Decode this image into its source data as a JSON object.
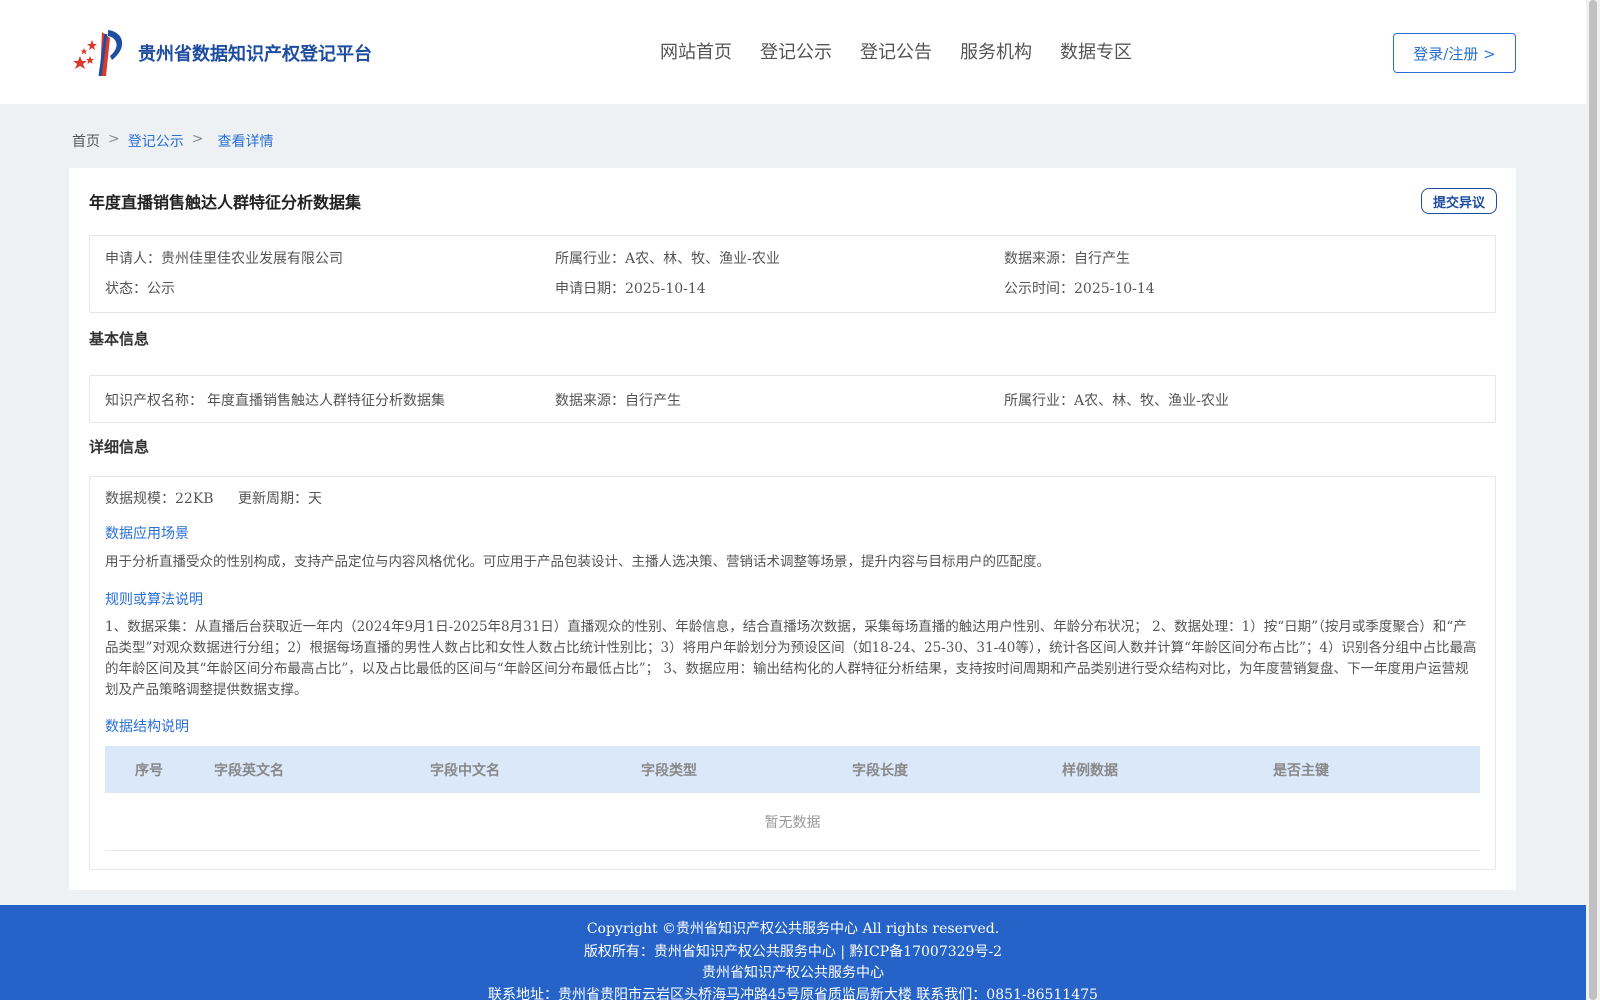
{
  "header": {
    "brand": "贵州省数据知识产权登记平台",
    "nav": [
      "网站首页",
      "登记公示",
      "登记公告",
      "服务机构",
      "数据专区"
    ],
    "login": "登录/注册 >"
  },
  "breadcrumb": {
    "home": "首页",
    "sep": ">",
    "publicity": "登记公示",
    "current": "查看详情"
  },
  "detail": {
    "title": "年度直播销售触达人群特征分析数据集",
    "objection_button": "提交异议",
    "summary": {
      "applicant_label": "申请人：",
      "applicant": "贵州佳里佳农业发展有限公司",
      "industry_label": "所属行业：",
      "industry": "A农、林、牧、渔业-农业",
      "source_label": "数据来源：",
      "source": "自行产生",
      "status_label": "状态：",
      "status": "公示",
      "apply_date_label": "申请日期：",
      "apply_date": "2025-10-14",
      "publicity_time_label": "公示时间：",
      "publicity_time": "2025-10-14"
    },
    "basic_title": "基本信息",
    "basic": {
      "ip_name_label": "知识产权名称：",
      "ip_name": "年度直播销售触达人群特征分析数据集",
      "source_label": "数据来源：",
      "source": "自行产生",
      "industry_label": "所属行业：",
      "industry": "A农、林、牧、渔业-农业"
    },
    "detail_title": "详细信息",
    "scale_label": "数据规模：",
    "scale": "22KB",
    "cycle_label": "更新周期：",
    "cycle": "天",
    "scenario_title": "数据应用场景",
    "scenario_text": "用于分析直播受众的性别构成，支持产品定位与内容风格优化。可应用于产品包装设计、主播人选决策、营销话术调整等场景，提升内容与目标用户的匹配度。",
    "algorithm_title": "规则或算法说明",
    "algorithm_text": "1、数据采集：从直播后台获取近一年内（2024年9月1日-2025年8月31日）直播观众的性别、年龄信息，结合直播场次数据，采集每场直播的触达用户性别、年龄分布状况； 2、数据处理：1）按“日期”（按月或季度聚合）和“产品类型”对观众数据进行分组；2）根据每场直播的男性人数占比和女性人数占比统计性别比；3）将用户年龄划分为预设区间（如18-24、25-30、31-40等），统计各区间人数并计算“年龄区间分布占比”；4）识别各分组中占比最高的年龄区间及其“年龄区间分布最高占比”，以及占比最低的区间与“年龄区间分布最低占比”； 3、数据应用：输出结构化的人群特征分析结果，支持按时间周期和产品类别进行受众结构对比，为年度营销复盘、下一年度用户运营规划及产品策略调整提供数据支撑。",
    "structure_title": "数据结构说明",
    "table_headers": [
      "序号",
      "字段英文名",
      "字段中文名",
      "字段类型",
      "字段长度",
      "样例数据",
      "是否主键"
    ],
    "empty_text": "暂无数据"
  },
  "footer": {
    "copyright": "Copyright ©贵州省知识产权公共服务中心 All rights reserved.",
    "owner": "版权所有：贵州省知识产权公共服务中心 | 黔ICP备17007329号-2",
    "org": "贵州省知识产权公共服务中心",
    "contact": "联系地址：贵州省贵阳市云岩区头桥海马冲路45号原省质监局新大楼 联系我们：0851-86511475"
  },
  "colors": {
    "primary": "#2a6fd6",
    "brand": "#1f4ea0",
    "footer": "#2563c8",
    "table_head": "#dbe8fa"
  }
}
